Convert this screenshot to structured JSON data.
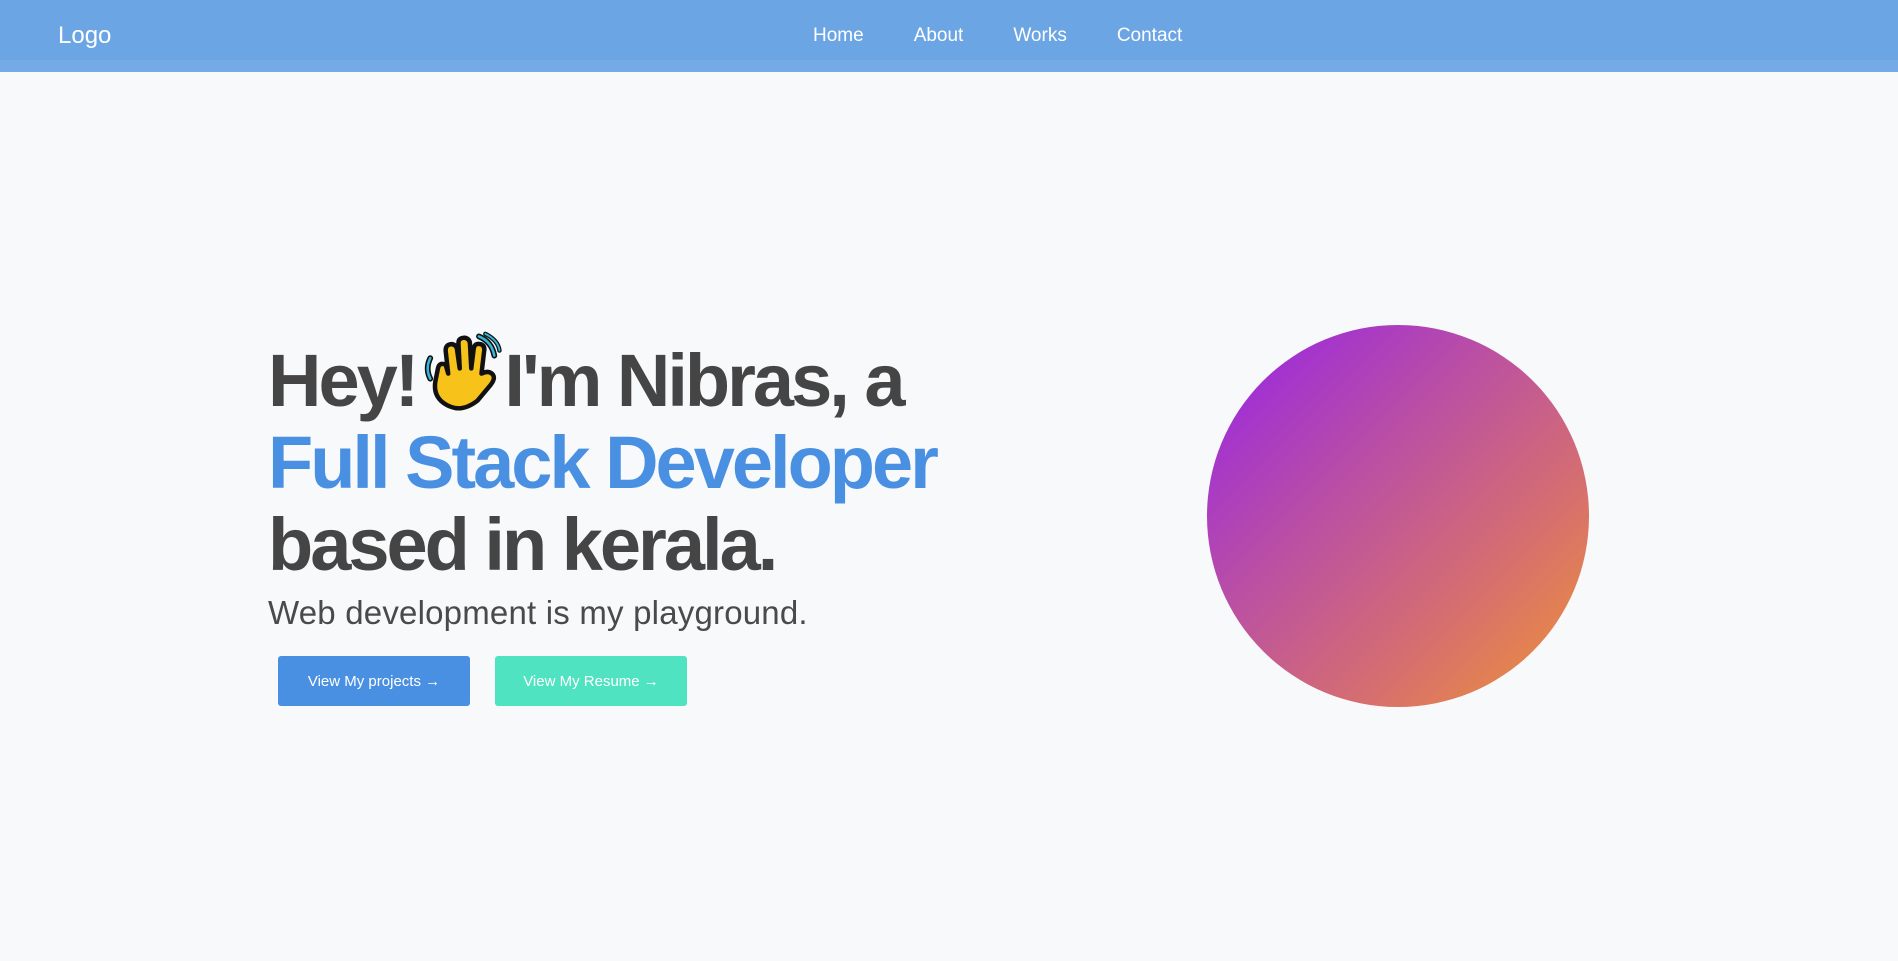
{
  "header": {
    "logo": "Logo",
    "nav": [
      "Home",
      "About",
      "Works",
      "Contact"
    ]
  },
  "hero": {
    "line1_before": "Hey!",
    "emoji": "waving-hand-icon",
    "line1_after": "I'm Nibras, a",
    "line2": "Full Stack Developer",
    "line3": "based in kerala.",
    "tagline": "Web development is my playground.",
    "buttons": {
      "projects": "View My projects →",
      "resume": "View My Resume →"
    }
  },
  "colors": {
    "navbar": "#6ca5e4",
    "accent": "#4a90e2",
    "teal": "#50e3c2",
    "heading": "#454545",
    "gradient_start": "#9421ea",
    "gradient_end": "#f09532"
  }
}
